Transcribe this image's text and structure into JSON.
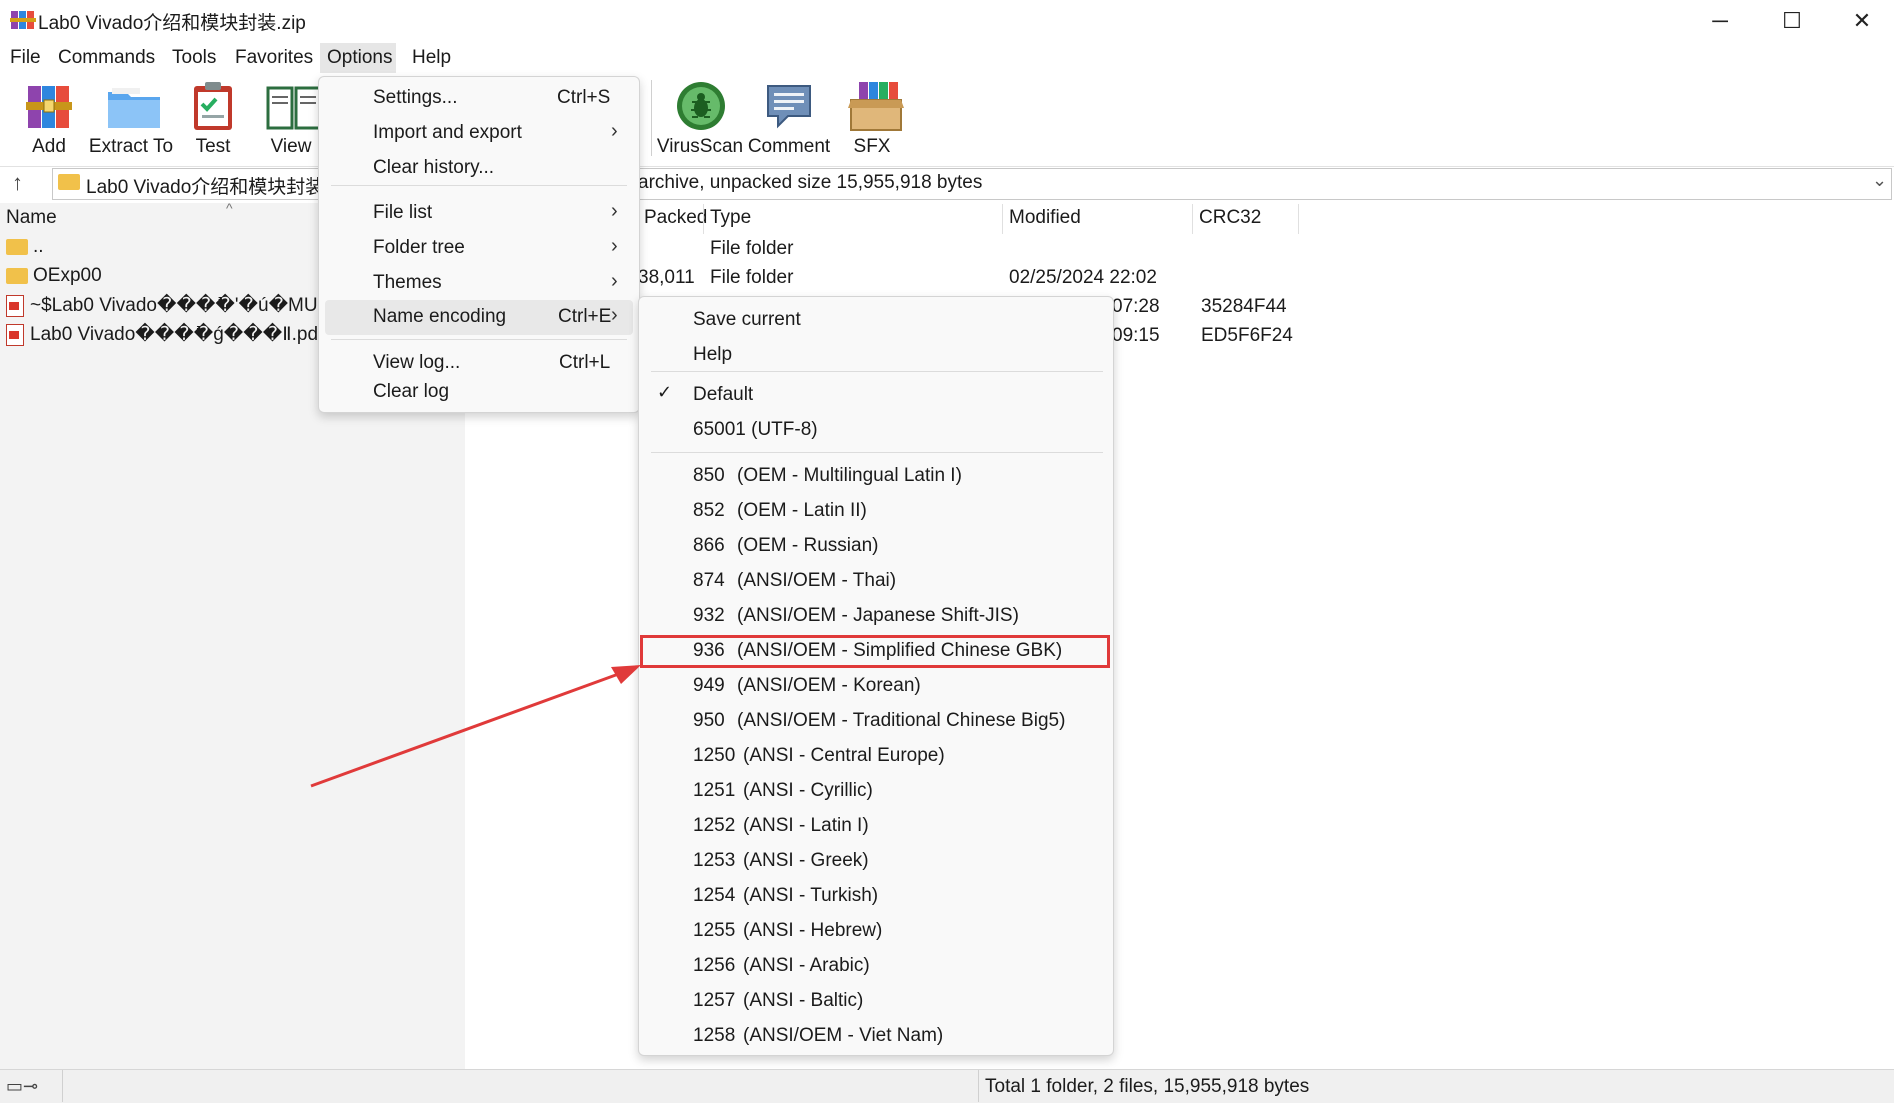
{
  "window": {
    "title": "Lab0 Vivado介绍和模块封装.zip",
    "icon": "winrar-icon",
    "controls": {
      "minimize": "─",
      "maximize": "☐",
      "close": "✕"
    }
  },
  "menubar": {
    "items": [
      "File",
      "Commands",
      "Tools",
      "Favorites",
      "Options",
      "Help"
    ],
    "active": "Options"
  },
  "toolbar": {
    "buttons": [
      {
        "label": "Add",
        "icon": "add-archive-icon"
      },
      {
        "label": "Extract To",
        "icon": "extract-folder-icon"
      },
      {
        "label": "Test",
        "icon": "test-clipboard-icon"
      },
      {
        "label": "View",
        "icon": "view-book-icon"
      },
      {
        "label": "VirusScan",
        "icon": "virus-scan-icon"
      },
      {
        "label": "Comment",
        "icon": "comment-icon"
      },
      {
        "label": "SFX",
        "icon": "sfx-box-icon"
      }
    ]
  },
  "address": {
    "path": "Lab0 Vivado介绍和模块封装.",
    "info": "archive, unpacked size 15,955,918 bytes"
  },
  "file_list": {
    "columns": {
      "name": "Name",
      "packed": "Packed",
      "type": "Type",
      "modified": "Modified",
      "crc": "CRC32"
    },
    "rows": [
      {
        "name": "..",
        "packed": "",
        "type": "File folder",
        "modified": "",
        "crc": "",
        "icon": "folder-icon"
      },
      {
        "name": "OExp00",
        "packed": "38,011",
        "type": "File folder",
        "modified": "02/25/2024 22:02",
        "crc": "",
        "icon": "folder-icon"
      },
      {
        "name": "~$Lab0 Vivado���ܺ�'�ú�MUX",
        "packed": "",
        "type": "",
        "modified": "07:28",
        "crc": "35284F44",
        "icon": "pptx-icon"
      },
      {
        "name": "Lab0 Vivado���ܺ�ǵ���Ⅱ.pdf",
        "packed": "",
        "type": "",
        "modified": "09:15",
        "crc": "ED5F6F24",
        "icon": "pdf-icon"
      }
    ]
  },
  "options_menu": {
    "items": [
      {
        "label": "Settings...",
        "shortcut": "Ctrl+S",
        "submenu": false
      },
      {
        "label": "Import and export",
        "shortcut": "",
        "submenu": true
      },
      {
        "label": "Clear history...",
        "shortcut": "",
        "submenu": false
      },
      {
        "label": "File list",
        "shortcut": "",
        "submenu": true
      },
      {
        "label": "Folder tree",
        "shortcut": "",
        "submenu": true
      },
      {
        "label": "Themes",
        "shortcut": "",
        "submenu": true
      },
      {
        "label": "Name encoding",
        "shortcut": "Ctrl+E",
        "submenu": true
      },
      {
        "label": "View log...",
        "shortcut": "Ctrl+L",
        "submenu": false
      },
      {
        "label": "Clear log",
        "shortcut": "",
        "submenu": false
      }
    ]
  },
  "encoding_menu": {
    "top_items": [
      "Save current",
      "Help"
    ],
    "default_items": [
      "Default",
      "65001 (UTF-8)"
    ],
    "checked": "Default",
    "codepages": [
      {
        "code": "850",
        "desc": "(OEM - Multilingual Latin I)"
      },
      {
        "code": "852",
        "desc": "(OEM - Latin II)"
      },
      {
        "code": "866",
        "desc": "(OEM - Russian)"
      },
      {
        "code": "874",
        "desc": "(ANSI/OEM - Thai)"
      },
      {
        "code": "932",
        "desc": "(ANSI/OEM - Japanese Shift-JIS)"
      },
      {
        "code": "936",
        "desc": "(ANSI/OEM - Simplified Chinese GBK)"
      },
      {
        "code": "949",
        "desc": "(ANSI/OEM - Korean)"
      },
      {
        "code": "950",
        "desc": "(ANSI/OEM - Traditional Chinese Big5)"
      },
      {
        "code": "1250",
        "desc": "(ANSI - Central Europe)"
      },
      {
        "code": "1251",
        "desc": "(ANSI - Cyrillic)"
      },
      {
        "code": "1252",
        "desc": "(ANSI - Latin I)"
      },
      {
        "code": "1253",
        "desc": "(ANSI - Greek)"
      },
      {
        "code": "1254",
        "desc": "(ANSI - Turkish)"
      },
      {
        "code": "1255",
        "desc": "(ANSI - Hebrew)"
      },
      {
        "code": "1256",
        "desc": "(ANSI - Arabic)"
      },
      {
        "code": "1257",
        "desc": "(ANSI - Baltic)"
      },
      {
        "code": "1258",
        "desc": "(ANSI/OEM - Viet Nam)"
      }
    ],
    "highlighted_code": "936"
  },
  "status": {
    "text": "Total 1 folder, 2 files, 15,955,918 bytes"
  },
  "colors": {
    "annotation_red": "#e03a3a",
    "folder_yellow": "#f1c14a"
  }
}
